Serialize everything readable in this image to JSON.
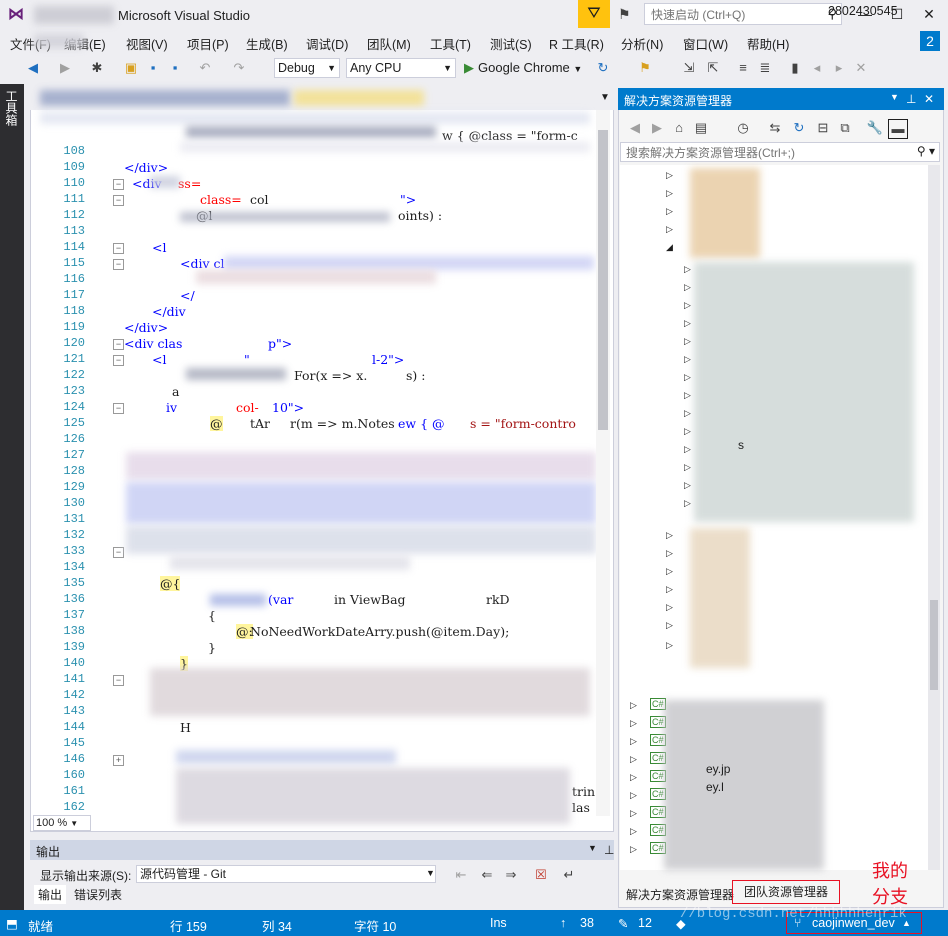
{
  "window": {
    "title": "Microsoft Visual Studio",
    "quick_launch_placeholder": "快速启动 (Ctrl+Q)"
  },
  "menu": [
    "文件(F)",
    "编辑(E)",
    "视图(V)",
    "项目(P)",
    "生成(B)",
    "调试(D)",
    "团队(M)",
    "工具(T)",
    "测试(S)",
    "R 工具(R)",
    "分析(N)",
    "窗口(W)",
    "帮助(H)"
  ],
  "user_id": "2802430545",
  "notification_count": "2",
  "toolbar": {
    "config": "Debug",
    "platform": "Any CPU",
    "run_target": "Google Chrome"
  },
  "left_strip": {
    "label": "工具箱"
  },
  "editor": {
    "zoom": "100 %",
    "lines": [
      {
        "n": "108",
        "fold": ""
      },
      {
        "n": "109",
        "fold": ""
      },
      {
        "n": "110",
        "fold": "−"
      },
      {
        "n": "111",
        "fold": "−"
      },
      {
        "n": "112",
        "fold": ""
      },
      {
        "n": "113",
        "fold": ""
      },
      {
        "n": "114",
        "fold": "−"
      },
      {
        "n": "115",
        "fold": "−"
      },
      {
        "n": "116",
        "fold": ""
      },
      {
        "n": "117",
        "fold": ""
      },
      {
        "n": "118",
        "fold": ""
      },
      {
        "n": "119",
        "fold": ""
      },
      {
        "n": "120",
        "fold": "−"
      },
      {
        "n": "121",
        "fold": "−"
      },
      {
        "n": "122",
        "fold": ""
      },
      {
        "n": "123",
        "fold": ""
      },
      {
        "n": "124",
        "fold": "−"
      },
      {
        "n": "125",
        "fold": ""
      },
      {
        "n": "126",
        "fold": ""
      },
      {
        "n": "127",
        "fold": ""
      },
      {
        "n": "128",
        "fold": ""
      },
      {
        "n": "129",
        "fold": ""
      },
      {
        "n": "130",
        "fold": ""
      },
      {
        "n": "131",
        "fold": ""
      },
      {
        "n": "132",
        "fold": ""
      },
      {
        "n": "133",
        "fold": "−"
      },
      {
        "n": "134",
        "fold": ""
      },
      {
        "n": "135",
        "fold": ""
      },
      {
        "n": "136",
        "fold": ""
      },
      {
        "n": "137",
        "fold": ""
      },
      {
        "n": "138",
        "fold": ""
      },
      {
        "n": "139",
        "fold": ""
      },
      {
        "n": "140",
        "fold": ""
      },
      {
        "n": "141",
        "fold": "−"
      },
      {
        "n": "142",
        "fold": ""
      },
      {
        "n": "143",
        "fold": ""
      },
      {
        "n": "144",
        "fold": ""
      },
      {
        "n": "145",
        "fold": ""
      },
      {
        "n": "146",
        "fold": "+"
      },
      {
        "n": "160",
        "fold": ""
      },
      {
        "n": "161",
        "fold": ""
      },
      {
        "n": "162",
        "fold": ""
      }
    ],
    "snippets": {
      "l107": "w { @class = \"form-c",
      "l109": "</div>",
      "l110a": "<div",
      "l110b": "ss=",
      "l111a": "class=",
      "l111b": "col",
      "l111c": "\">",
      "l112a": "@l",
      "l112b": "oints) :",
      "l114": "<l",
      "l115": "<div cl",
      "l117": "</",
      "l118": "</div",
      "l119": "</div>",
      "l120a": "<div clas",
      "l120b": "p\">",
      "l121a": "<l",
      "l121b": "\"",
      "l121c": "l-2\">",
      "l122a": "For(x => x.",
      "l122b": "s) :",
      "l123": "a",
      "l124a": "iv",
      "l124b": "col-",
      "l124c": "10\">",
      "l125a": "@",
      "l125b": "tAr",
      "l125c": "r(m => m.Notes",
      "l125d": "ew { @",
      "l125e": "s = \"form-contro",
      "l135": "@{",
      "l136a": "(var",
      "l136b": "in ViewBag",
      "l136c": "rkD",
      "l137": "{",
      "l138a": "@:",
      "l138b": "NoNeedWorkDateArry.push(@item.Day);",
      "l139": "}",
      "l140": "}",
      "l144": "H",
      "l161": "trin",
      "l162": "las"
    }
  },
  "output": {
    "title": "输出",
    "source_label": "显示输出来源(S):",
    "source_value": "源代码管理 - Git",
    "tabs": [
      "输出",
      "错误列表"
    ]
  },
  "solution_explorer": {
    "title": "解决方案资源管理器",
    "search_placeholder": "搜索解决方案资源管理器(Ctrl+;)",
    "tabs": [
      "解决方案资源管理器",
      "团队资源管理器"
    ],
    "cs_label": "C#",
    "partial_texts": [
      "s",
      "ey.jp",
      "ey.l"
    ]
  },
  "annotation": {
    "my_branch": "我的分支"
  },
  "status": {
    "ready": "就绪",
    "line": "行 159",
    "col": "列 34",
    "char": "字符 10",
    "ins": "Ins",
    "up_count": "38",
    "pen_count": "12",
    "branch": "caojinwen_dev",
    "watermark": "//blog.csdn.net/hhhhhhenrik"
  },
  "colors": {
    "accent": "#007acc",
    "vs_purple": "#68217a",
    "highlight_red": "#e81123",
    "filter_yellow": "#ffc20e"
  }
}
